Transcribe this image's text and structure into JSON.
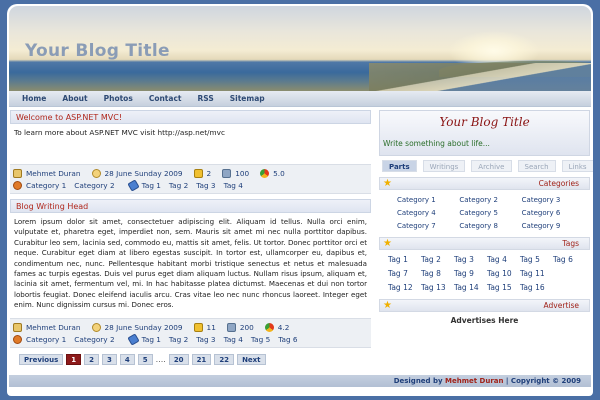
{
  "header": {
    "blog_title": "Your Blog Title"
  },
  "nav": [
    "Home",
    "About",
    "Photos",
    "Contact",
    "RSS",
    "Sitemap"
  ],
  "welcome": {
    "title": "Welcome to ASP.NET MVC!",
    "text": "To learn more about ASP.NET MVC visit http://asp.net/mvc"
  },
  "meta1": {
    "author": "Mehmet Duran",
    "date": "28 June Sunday 2009",
    "comments": "2",
    "views": "100",
    "rating": "5.0",
    "cat1": "Category 1",
    "cat2": "Category 2",
    "tags": [
      "Tag 1",
      "Tag 2",
      "Tag 3",
      "Tag 4"
    ]
  },
  "post": {
    "title": "Blog Writing Head",
    "body": "Lorem ipsum dolor sit amet, consectetuer adipiscing elit. Aliquam id tellus. Nulla orci enim, vulputate et, pharetra eget, imperdiet non, sem. Mauris sit amet mi nec nulla porttitor dapibus. Curabitur leo sem, lacinia sed, commodo eu, mattis sit amet, felis. Ut tortor. Donec porttitor orci et neque. Curabitur eget diam at libero egestas suscipit. In tortor est, ullamcorper eu, dapibus et, condimentum nec, nunc. Pellentesque habitant morbi tristique senectus et netus et malesuada fames ac turpis egestas. Duis vel purus eget diam aliquam luctus. Nullam risus ipsum, aliquam et, lacinia sit amet, fermentum vel, mi. In hac habitasse platea dictumst. Maecenas et dui non tortor lobortis feugiat. Donec eleifend iaculis arcu. Cras vitae leo nec nunc rhoncus laoreet. Integer eget enim. Nunc dignissim cursus mi. Donec eros."
  },
  "meta2": {
    "author": "Mehmet Duran",
    "date": "28 June Sunday 2009",
    "comments": "11",
    "views": "200",
    "rating": "4.2",
    "cat1": "Category 1",
    "cat2": "Category 2",
    "tags": [
      "Tag 1",
      "Tag 2",
      "Tag 3",
      "Tag 4",
      "Tag 5",
      "Tag 6"
    ]
  },
  "pager": {
    "prev": "Previous",
    "pages": [
      "1",
      "2",
      "3",
      "4",
      "5"
    ],
    "dots": "....",
    "pages2": [
      "20",
      "21",
      "22"
    ],
    "next": "Next"
  },
  "sidebar": {
    "title": "Your Blog Title",
    "subtitle": "Write something about life...",
    "tabs": [
      "Parts",
      "Writings",
      "Archive",
      "Search",
      "Links"
    ],
    "categories_title": "Categories",
    "categories": [
      "Category 1",
      "Category 2",
      "Category 3",
      "Category 4",
      "Category 5",
      "Category 6",
      "Category 7",
      "Category 8",
      "Category 9"
    ],
    "tags_title": "Tags",
    "tags": [
      "Tag 1",
      "Tag 2",
      "Tag 3",
      "Tag 4",
      "Tag 5",
      "Tag 6",
      "Tag 7",
      "Tag 8",
      "Tag 9",
      "Tag 10",
      "Tag 11",
      "Tag 12",
      "Tag 13",
      "Tag 14",
      "Tag 15",
      "Tag 16"
    ],
    "advertise_title": "Advertise",
    "advertise_text": "Advertises Here"
  },
  "footer": {
    "prefix": "Designed by ",
    "name": "Mehmet Duran",
    "suffix": " | Copyright © 2009"
  },
  "colors": {
    "accent": "#a0231a",
    "link": "#1f3f7a",
    "page_bg": "#4a6fa5"
  }
}
